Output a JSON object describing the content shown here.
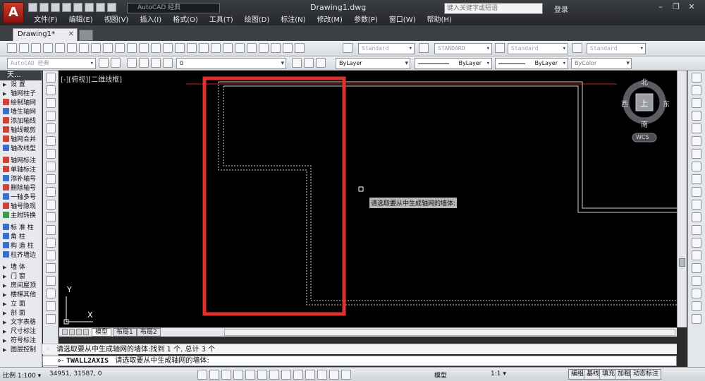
{
  "titlebar": {
    "app_letter": "A",
    "workspace": "AutoCAD 经典",
    "doc_title": "Drawing1.dwg",
    "search_placeholder": "键入关键字或短语",
    "login": "登录",
    "window_controls": [
      "–",
      "❐",
      "✕"
    ],
    "menu": [
      "文件(F)",
      "编辑(E)",
      "视图(V)",
      "插入(I)",
      "格式(O)",
      "工具(T)",
      "绘图(D)",
      "标注(N)",
      "修改(M)",
      "参数(P)",
      "窗口(W)",
      "帮助(H)"
    ]
  },
  "tabs": {
    "doc_tab": "Drawing1*",
    "close_glyph": "✕"
  },
  "toolbar1": {
    "text_style": "Standard",
    "dim_style": "STANDARD",
    "table_style": "Standard",
    "mleader_style": "Standard"
  },
  "toolbar2": {
    "workspace": "AutoCAD 经典",
    "layer": "0",
    "color": "ByLayer",
    "linetype": "ByLayer",
    "lineweight": "ByLayer",
    "plotstyle": "ByColor"
  },
  "leftpanel": {
    "title": "天...",
    "items": [
      {
        "label": "设  置",
        "kind": "tri"
      },
      {
        "label": "轴网柱子",
        "kind": "tri"
      },
      {
        "label": "绘制轴网",
        "kind": "r"
      },
      {
        "label": "墙生轴网",
        "kind": "b"
      },
      {
        "label": "添加轴线",
        "kind": "r"
      },
      {
        "label": "轴线裁剪",
        "kind": "r"
      },
      {
        "label": "轴网合并",
        "kind": "r"
      },
      {
        "label": "轴改线型",
        "kind": "b"
      },
      {
        "label": "",
        "kind": "sep"
      },
      {
        "label": "轴网标注",
        "kind": "r"
      },
      {
        "label": "单轴标注",
        "kind": "r"
      },
      {
        "label": "添补轴号",
        "kind": "b"
      },
      {
        "label": "删除轴号",
        "kind": "r"
      },
      {
        "label": "一轴多号",
        "kind": "b"
      },
      {
        "label": "轴号隐现",
        "kind": "r"
      },
      {
        "label": "主附转换",
        "kind": "g"
      },
      {
        "label": "",
        "kind": "sep"
      },
      {
        "label": "标 准 柱",
        "kind": "b"
      },
      {
        "label": "角   柱",
        "kind": "b"
      },
      {
        "label": "构 造 柱",
        "kind": "b"
      },
      {
        "label": "柱齐墙边",
        "kind": "b"
      },
      {
        "label": "",
        "kind": "sep"
      },
      {
        "label": "墙   体",
        "kind": "tri"
      },
      {
        "label": "门   窗",
        "kind": "tri"
      },
      {
        "label": "房间屋顶",
        "kind": "tri"
      },
      {
        "label": "楼梯其他",
        "kind": "tri"
      },
      {
        "label": "立   面",
        "kind": "tri"
      },
      {
        "label": "剖   面",
        "kind": "tri"
      },
      {
        "label": "文字表格",
        "kind": "tri"
      },
      {
        "label": "尺寸标注",
        "kind": "tri"
      },
      {
        "label": "符号标注",
        "kind": "tri"
      },
      {
        "label": "图层控制",
        "kind": "tri"
      }
    ]
  },
  "canvas": {
    "view_label": "[-][俯视][二维线框]",
    "tooltip": "请选取要从中生成轴网的墙体:",
    "ucs_x": "X",
    "ucs_y": "Y",
    "viewcube": {
      "north": "北",
      "south": "南",
      "east": "东",
      "west": "西",
      "top": "上",
      "wcs": "WCS"
    }
  },
  "layouts": {
    "tabs": [
      "模型",
      "布局1",
      "布局2"
    ],
    "active": "模型"
  },
  "command": {
    "history": "请选取要从中生成轴网的墙体:找到 1 个, 总计 3 个",
    "prompt_prefix": "»-",
    "current_cmd": "TWALL2AXIS",
    "current_prompt": "请选取要从中生成轴网的墙体:",
    "close_glyph": "✕"
  },
  "statusbar": {
    "scale": "比例 1:100 ▾",
    "coords": "34951, 31587, 0",
    "model": "模型",
    "annot_scale": "1:1 ▾",
    "buttons": [
      "编组",
      "基线",
      "填充",
      "加粗",
      "动态标注"
    ]
  },
  "colors": {
    "highlight_red": "#e03030",
    "canvas_bg": "#000000",
    "wall_line": "#d0d0d0",
    "axis_red": "#c02020"
  }
}
